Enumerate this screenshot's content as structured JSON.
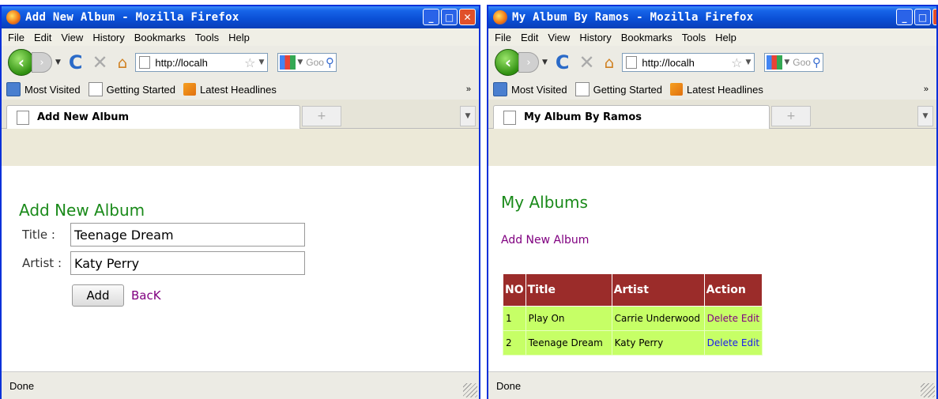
{
  "windows": [
    {
      "title": "Add New Album - Mozilla Firefox",
      "menu": [
        "File",
        "Edit",
        "View",
        "History",
        "Bookmarks",
        "Tools",
        "Help"
      ],
      "url": "http://localh",
      "search_placeholder": "Goo",
      "bookmarks": [
        "Most Visited",
        "Getting Started",
        "Latest Headlines"
      ],
      "bookmarks_overflow": "»",
      "tab_title": "Add New Album",
      "status": "Done",
      "page": {
        "heading": "Add New Album",
        "title_label": "Title  :",
        "title_value": "Teenage Dream",
        "artist_label": "Artist :",
        "artist_value": "Katy Perry",
        "add_button": "Add",
        "back_link": "BacK"
      }
    },
    {
      "title": "My Album By Ramos - Mozilla Firefox",
      "menu": [
        "File",
        "Edit",
        "View",
        "History",
        "Bookmarks",
        "Tools",
        "Help"
      ],
      "url": "http://localh",
      "search_placeholder": "Goo",
      "bookmarks": [
        "Most Visited",
        "Getting Started",
        "Latest Headlines"
      ],
      "bookmarks_overflow": "»",
      "tab_title": "My Album By Ramos",
      "status": "Done",
      "page": {
        "heading": "My Albums",
        "add_link": "Add New Album",
        "table": {
          "headers": [
            "NO",
            "Title",
            "Artist",
            "Action"
          ],
          "rows": [
            {
              "no": "1",
              "title": "Play On",
              "artist": "Carrie Underwood",
              "delete": "Delete",
              "edit": "Edit"
            },
            {
              "no": "2",
              "title": "Teenage Dream",
              "artist": "Katy Perry",
              "delete": "Delete",
              "edit": "Edit"
            }
          ]
        }
      }
    }
  ],
  "colors": {
    "heading_green": "#1a8a1a",
    "link_purple": "#800080",
    "table_header": "#9b2c2a",
    "table_row": "#c6ff66"
  }
}
